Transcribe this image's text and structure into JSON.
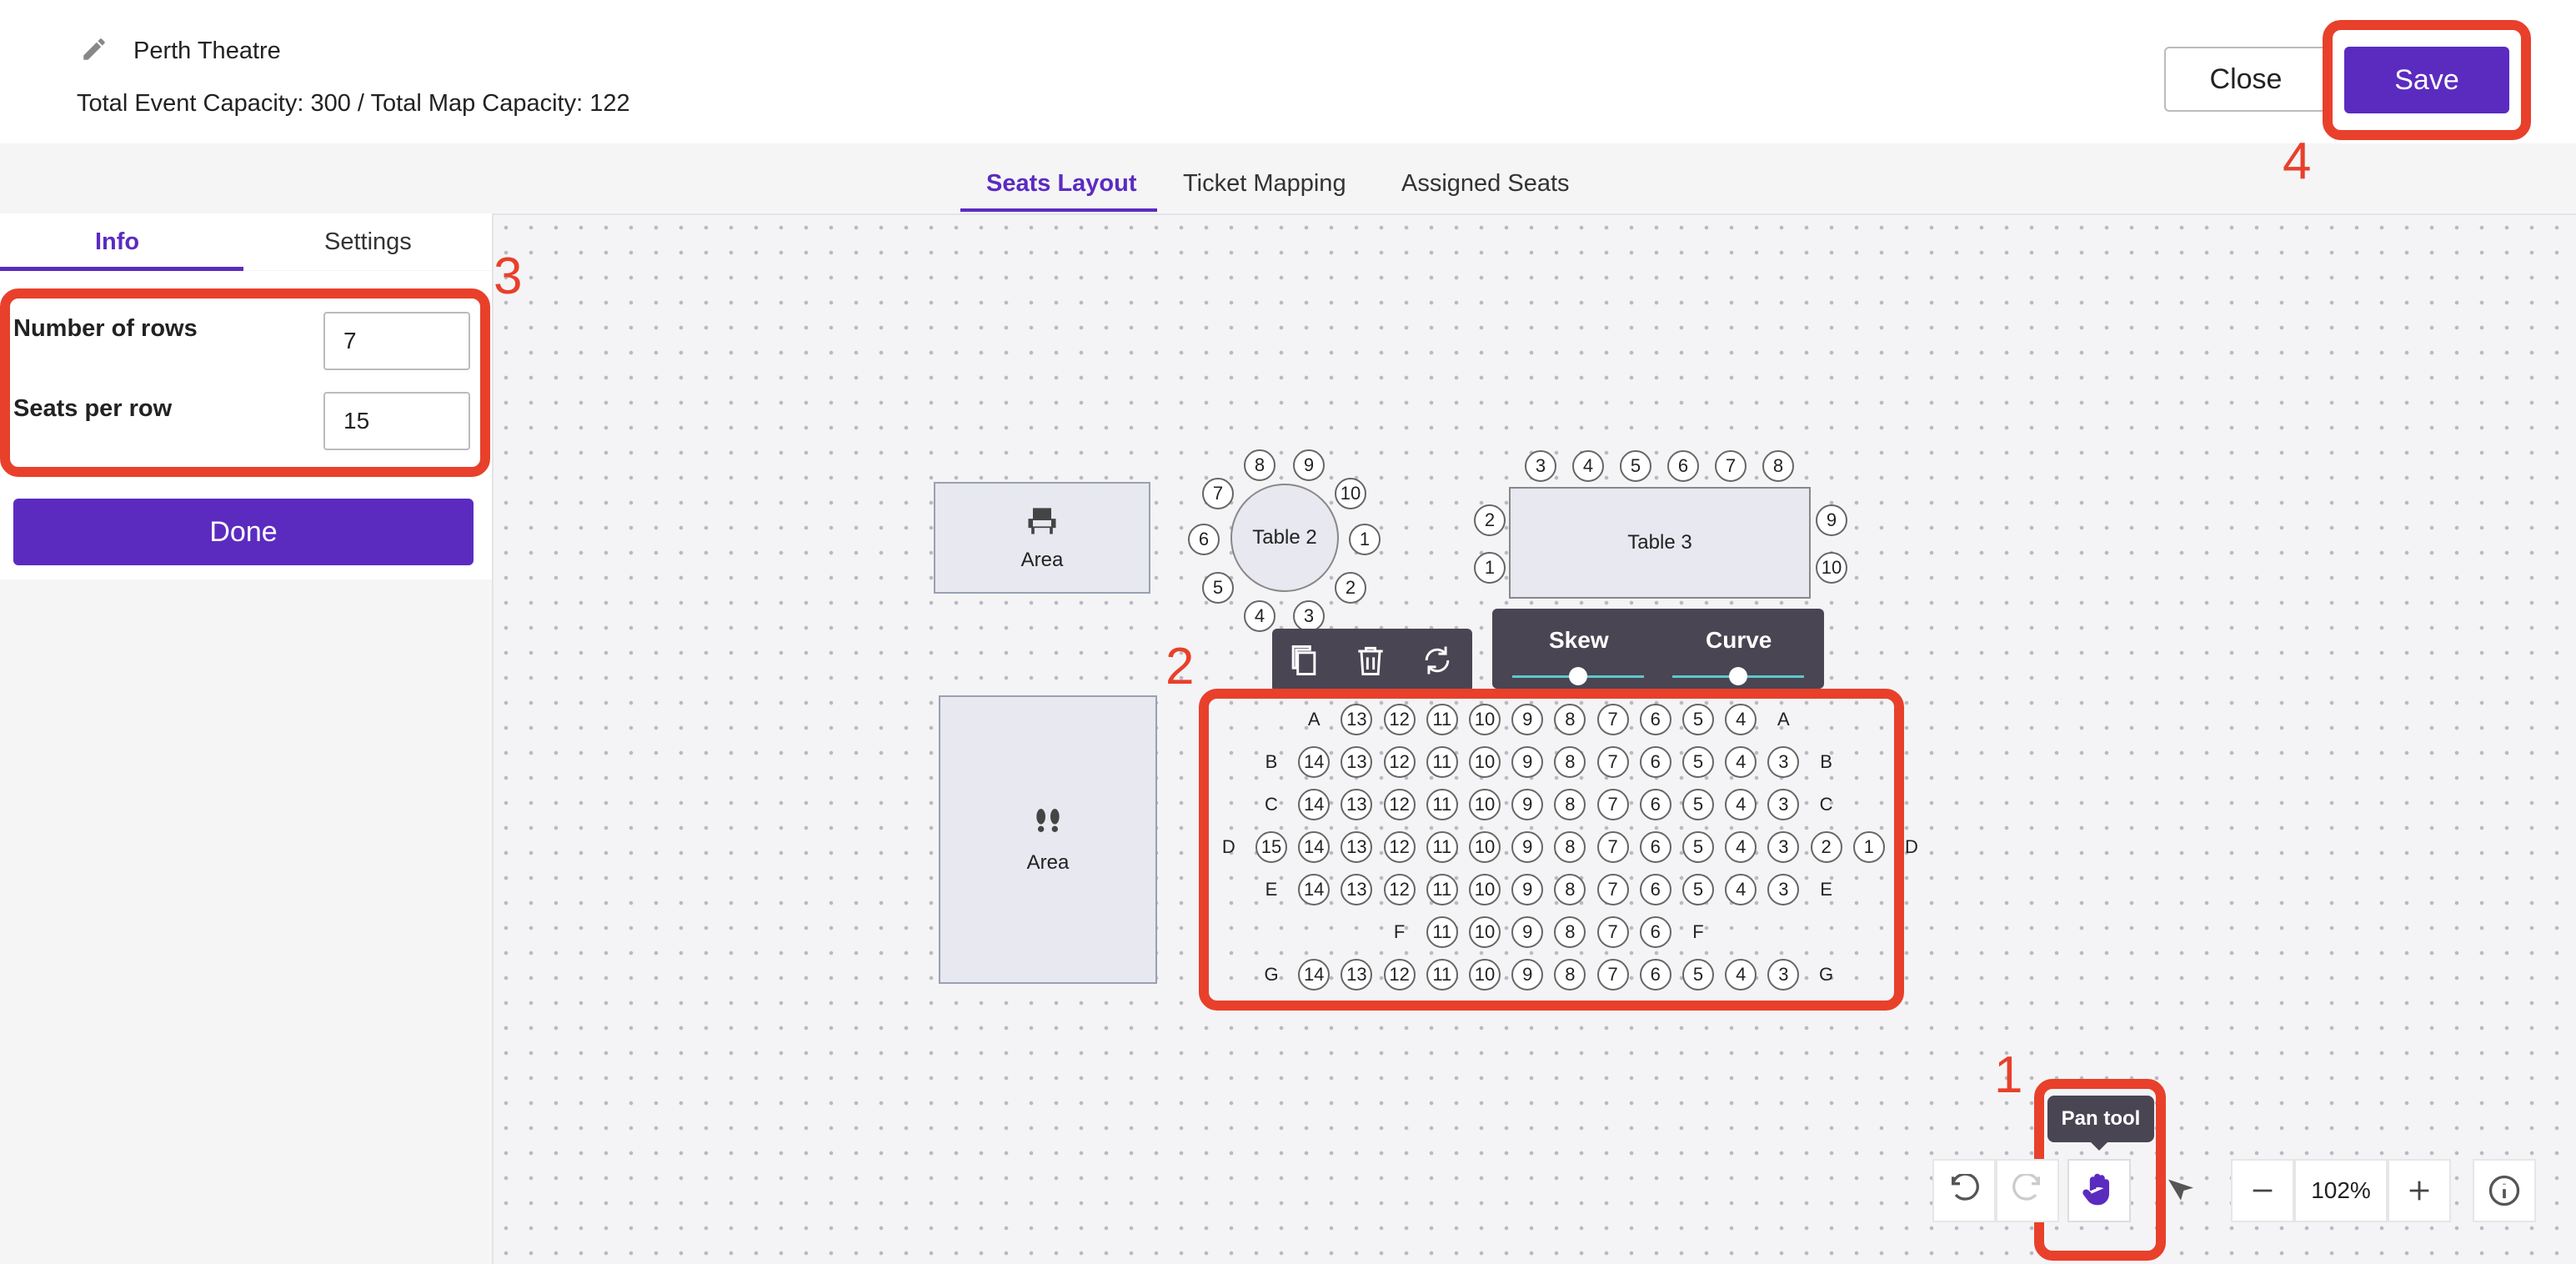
{
  "header": {
    "venue_name": "Perth Theatre",
    "capacity_text": "Total Event Capacity: 300 / Total Map Capacity: 122",
    "close_label": "Close",
    "save_label": "Save"
  },
  "tabs": [
    "Seats Layout",
    "Ticket Mapping",
    "Assigned Seats"
  ],
  "left_panel": {
    "tabs": [
      "Info",
      "Settings"
    ],
    "rows_label": "Number of rows",
    "rows_value": "7",
    "seats_label": "Seats per row",
    "seats_value": "15",
    "done_label": "Done"
  },
  "canvas": {
    "area_top_label": "Area",
    "area_bottom_label": "Area",
    "table2_label": "Table 2",
    "table2_seats": [
      "8",
      "9",
      "10",
      "1",
      "2",
      "3",
      "4",
      "5",
      "6",
      "7"
    ],
    "table3_label": "Table 3",
    "table3_top_seats": [
      "3",
      "4",
      "5",
      "6",
      "7",
      "8"
    ],
    "table3_left_seats": [
      "2",
      "1"
    ],
    "table3_right_seats": [
      "9",
      "10"
    ],
    "skew_label": "Skew",
    "curve_label": "Curve",
    "rows": [
      {
        "label": "A",
        "seats": [
          "13",
          "12",
          "11",
          "10",
          "9",
          "8",
          "7",
          "6",
          "5",
          "4"
        ]
      },
      {
        "label": "B",
        "seats": [
          "14",
          "13",
          "12",
          "11",
          "10",
          "9",
          "8",
          "7",
          "6",
          "5",
          "4",
          "3"
        ]
      },
      {
        "label": "C",
        "seats": [
          "14",
          "13",
          "12",
          "11",
          "10",
          "9",
          "8",
          "7",
          "6",
          "5",
          "4",
          "3"
        ]
      },
      {
        "label": "D",
        "seats": [
          "15",
          "14",
          "13",
          "12",
          "11",
          "10",
          "9",
          "8",
          "7",
          "6",
          "5",
          "4",
          "3",
          "2",
          "1"
        ]
      },
      {
        "label": "E",
        "seats": [
          "14",
          "13",
          "12",
          "11",
          "10",
          "9",
          "8",
          "7",
          "6",
          "5",
          "4",
          "3"
        ]
      },
      {
        "label": "F",
        "seats": [
          "11",
          "10",
          "9",
          "8",
          "7",
          "6"
        ]
      },
      {
        "label": "G",
        "seats": [
          "14",
          "13",
          "12",
          "11",
          "10",
          "9",
          "8",
          "7",
          "6",
          "5",
          "4",
          "3"
        ]
      }
    ]
  },
  "bottom_toolbar": {
    "tooltip": "Pan tool",
    "zoom": "102%"
  },
  "annotations": [
    "1",
    "2",
    "3",
    "4"
  ],
  "colors": {
    "accent": "#5b2bc0",
    "highlight": "#e8402b"
  }
}
